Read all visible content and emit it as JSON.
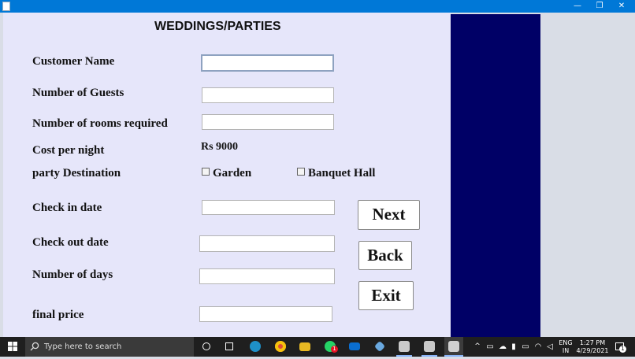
{
  "window": {
    "controls": {
      "minimize": "—",
      "restore": "❐",
      "close": "✕"
    }
  },
  "form": {
    "title": "WEDDINGS/PARTIES",
    "labels": {
      "customer_name": "Customer Name",
      "guests": "Number of Guests",
      "rooms": "Number of rooms required",
      "cost": "Cost per night",
      "destination": "party Destination",
      "checkin": "Check in date",
      "checkout": "Check out date",
      "days": "Number of days",
      "final_price": "final price"
    },
    "cost_value": "Rs 9000",
    "destination_options": [
      "Garden",
      "Banquet Hall"
    ],
    "fields": {
      "customer_name": "",
      "guests": "",
      "rooms": "",
      "checkin": "",
      "checkout": "",
      "days": "",
      "final_price": ""
    },
    "buttons": {
      "next": "Next",
      "back": "Back",
      "exit": "Exit"
    }
  },
  "taskbar": {
    "search_placeholder": "Type here to search",
    "language": "ENG",
    "region": "IN",
    "time": "1:27 PM",
    "date": "4/29/2021",
    "whatsapp_badge": "1",
    "notification_count": "1"
  },
  "colors": {
    "titlebar": "#0078d7",
    "form_bg": "#e6e6fa",
    "navy_panel": "#000066",
    "taskbar": "#1f1f1f"
  }
}
